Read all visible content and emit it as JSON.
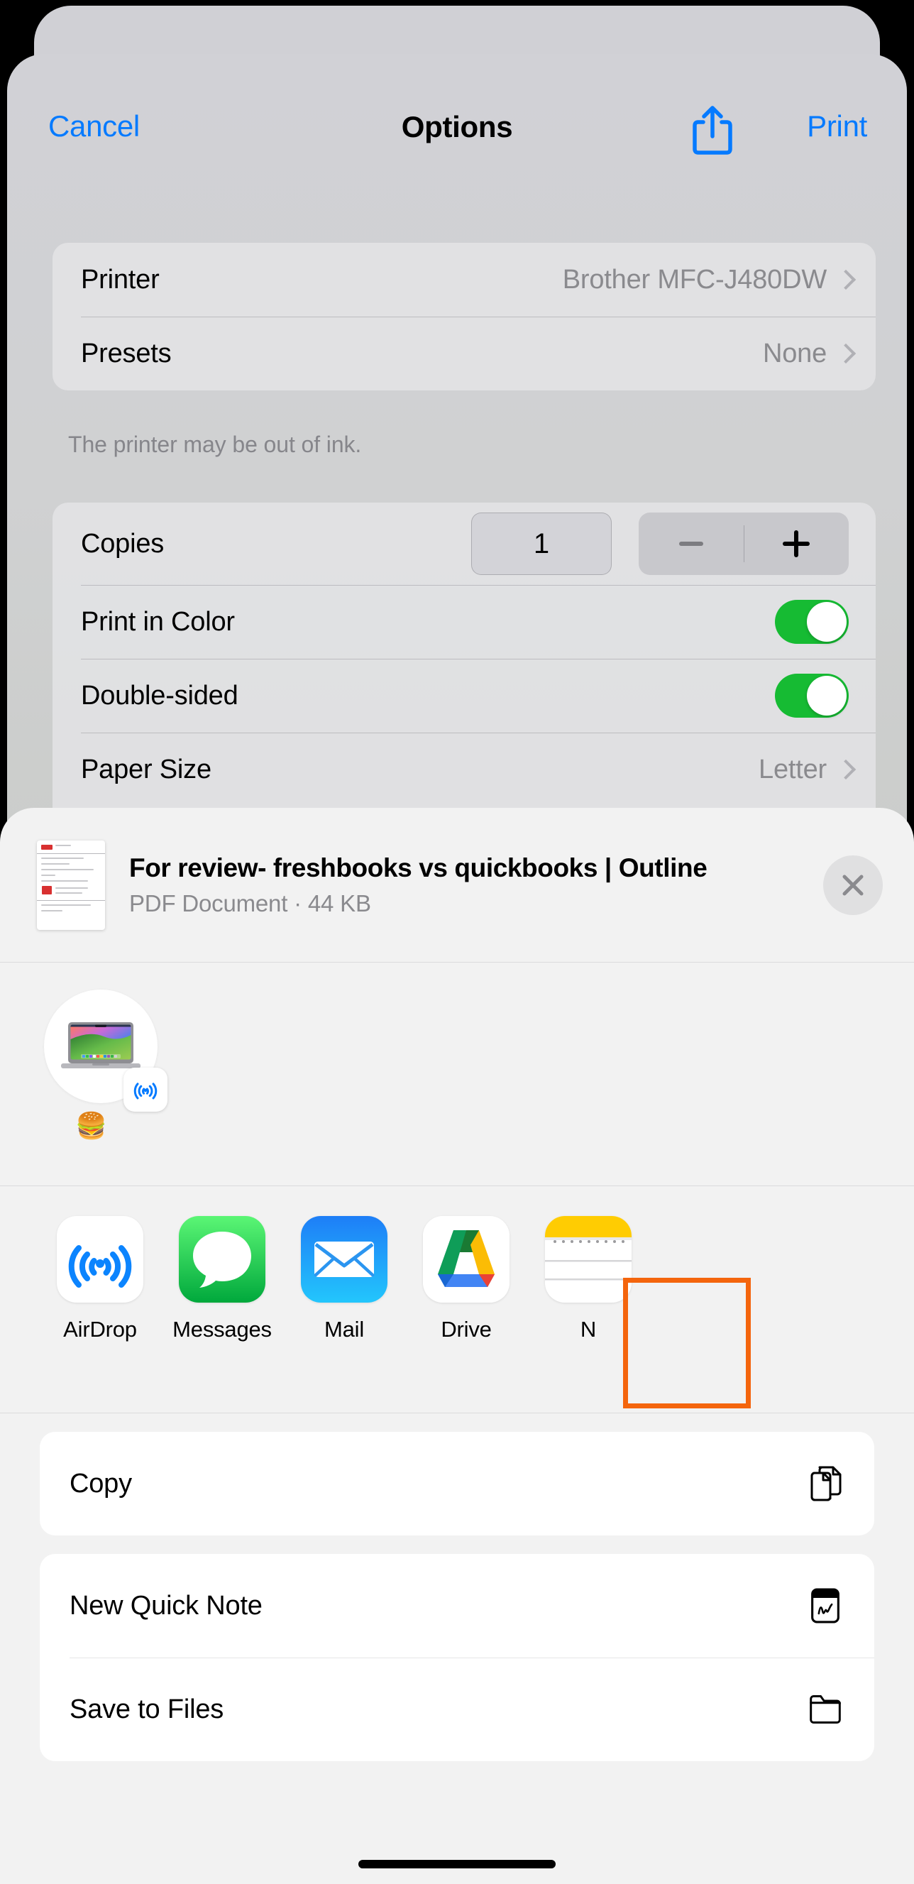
{
  "print_options": {
    "nav": {
      "cancel_label": "Cancel",
      "title": "Options",
      "share_icon": "share-up-arrow-icon",
      "print_label": "Print"
    },
    "printer_group": [
      {
        "label": "Printer",
        "value": "Brother MFC-J480DW"
      },
      {
        "label": "Presets",
        "value": "None"
      }
    ],
    "footnote": "The printer may be out of ink.",
    "settings_group": {
      "copies": {
        "label": "Copies",
        "value": "1",
        "minus_label": "minus-icon",
        "plus_label": "plus-icon"
      },
      "toggles": [
        {
          "label": "Print in Color",
          "state": "on"
        },
        {
          "label": "Double-sided",
          "state": "on"
        }
      ],
      "paper_size": {
        "label": "Paper Size",
        "value": "Letter"
      }
    }
  },
  "share_sheet": {
    "document": {
      "title": "For review- freshbooks vs quickbooks | Outline",
      "subtitle": "PDF Document · 44 KB",
      "thumbnail_name": "pdf-page-thumbnail",
      "close_icon": "close-icon"
    },
    "airdrop": {
      "device_name": "🍔",
      "device_icon": "macbook-icon",
      "badge_icon": "airdrop-icon"
    },
    "apps": [
      {
        "label": "AirDrop",
        "icon": "airdrop-icon"
      },
      {
        "label": "Messages",
        "icon": "messages-icon"
      },
      {
        "label": "Mail",
        "icon": "mail-icon"
      },
      {
        "label": "Drive",
        "icon": "google-drive-icon",
        "highlighted": true
      },
      {
        "label": "N",
        "icon": "notes-icon"
      }
    ],
    "actions": [
      {
        "label": "Copy",
        "icon": "copy-documents-icon"
      },
      {
        "label": "New Quick Note",
        "icon": "quick-note-icon"
      },
      {
        "label": "Save to Files",
        "icon": "folder-icon"
      }
    ]
  },
  "colors": {
    "accent_blue": "#057aff",
    "toggle_green": "#16bb33",
    "highlight_orange": "#f4650d",
    "sheet_background": "#f2f2f2",
    "print_sheet_background": "#d1d1d6"
  }
}
